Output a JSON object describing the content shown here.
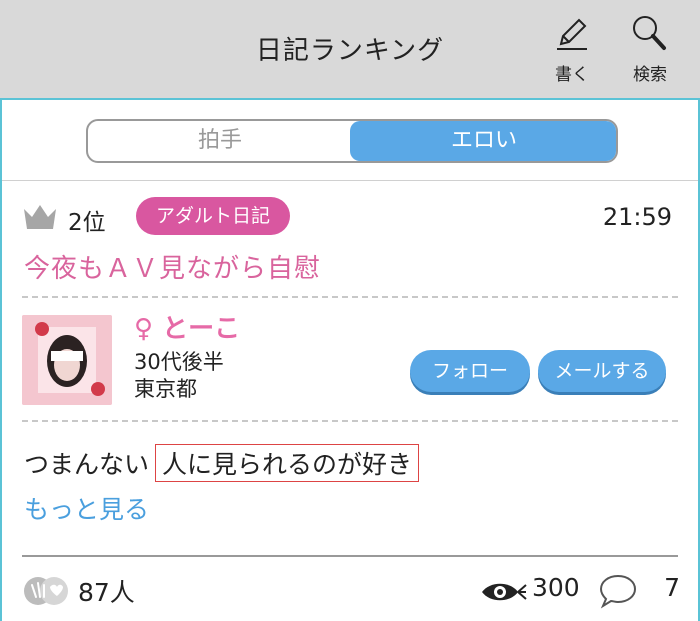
{
  "header": {
    "title": "日記ランキング",
    "write_label": "書く",
    "search_label": "検索"
  },
  "tabs": [
    {
      "label": "拍手",
      "selected": false
    },
    {
      "label": "エロい",
      "selected": true
    }
  ],
  "post": {
    "rank": "2位",
    "category": "アダルト日記",
    "time": "21:59",
    "title": "今夜もＡＶ見ながら自慰",
    "user": {
      "gender_symbol": "♀",
      "name": "とーこ",
      "age": "30代後半",
      "location": "東京都"
    },
    "follow_label": "フォロー",
    "mail_label": "メールする",
    "body_prefix": "つまんない",
    "body_highlight": "人に見られるのが好き",
    "more_label": "もっと見る",
    "claps": "87人",
    "views": "300",
    "comments": "7"
  },
  "colors": {
    "accent_blue": "#5aa8e6",
    "adult_tag": "#d957a0",
    "title_pink": "#d9649d",
    "frame_cyan": "#5bc3d6",
    "header_bg": "#d9d9d9"
  }
}
